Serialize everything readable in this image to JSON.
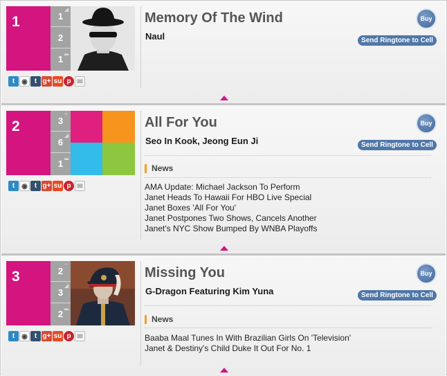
{
  "entries": [
    {
      "rank": "1",
      "stats": [
        "1",
        "2",
        "1"
      ],
      "title": "Memory Of The Wind",
      "artist": "Naul",
      "buy_label": "Buy",
      "ringtone_label": "Send Ringtone to Cell",
      "news_heading": "",
      "news": []
    },
    {
      "rank": "2",
      "stats": [
        "3",
        "6",
        "1"
      ],
      "title": "All For You",
      "artist": "Seo In Kook, Jeong Eun Ji",
      "buy_label": "Buy",
      "ringtone_label": "Send Ringtone to Cell",
      "news_heading": "News",
      "news": [
        "AMA Update: Michael Jackson To Perform",
        "Janet Heads To Hawaii For HBO Live Special",
        "Janet Boxes 'All For You'",
        "Janet Postpones Two Shows, Cancels Another",
        "Janet's NYC Show Bumped By WNBA Playoffs"
      ]
    },
    {
      "rank": "3",
      "stats": [
        "2",
        "3",
        "2"
      ],
      "title": "Missing You",
      "artist": "G-Dragon Featuring Kim Yuna",
      "buy_label": "Buy",
      "ringtone_label": "Send Ringtone to Cell",
      "news_heading": "News",
      "news": [
        "Baaba Maal Tunes In With Brazilian Girls On 'Television'",
        "Janet & Destiny's Child Duke It Out For No. 1"
      ]
    }
  ],
  "share_icons": [
    "twitter-icon",
    "reddit-icon",
    "tumblr-icon",
    "google-plus-icon",
    "stumbleupon-icon",
    "pinterest-icon",
    "email-icon"
  ],
  "colors": {
    "rank_magenta": "#d4147f",
    "stat_gray": "#a3a3a3",
    "button_blue": "#4f77a8",
    "news_accent": "#f0a020"
  }
}
